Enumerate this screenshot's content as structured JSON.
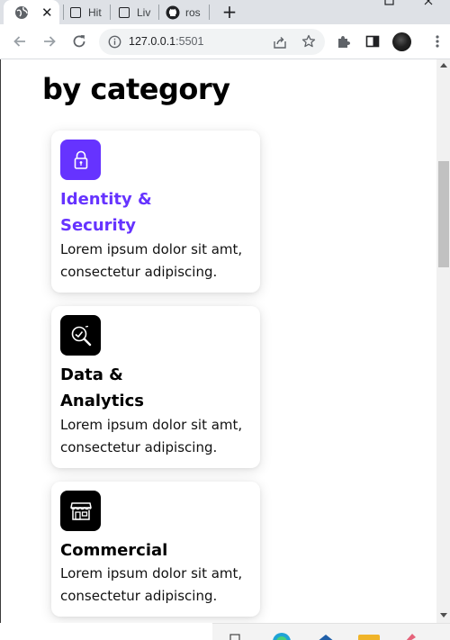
{
  "browser": {
    "tabs": [
      {
        "title": "",
        "active": true
      },
      {
        "title": "Hit",
        "active": false
      },
      {
        "title": "Liv",
        "active": false
      },
      {
        "title": "ros",
        "active": false
      }
    ],
    "url_host": "127.0.0.1",
    "url_port": ":5501"
  },
  "page": {
    "heading": "by category",
    "cards": [
      {
        "title_line1": "Identity &",
        "title_line2": "Security",
        "text_line1": "Lorem ipsum dolor sit amt,",
        "text_line2": "consectetur adipiscing.",
        "icon": "lock-icon",
        "icon_bg": "#6633ff"
      },
      {
        "title_line1": "Data &",
        "title_line2": "Analytics",
        "text_line1": "Lorem ipsum dolor sit amt,",
        "text_line2": "consectetur adipiscing.",
        "icon": "analytics-magnifier-icon",
        "icon_bg": "#000000"
      },
      {
        "title_line1": "Commercial",
        "text_line1": "Lorem ipsum dolor sit amt,",
        "text_line2": "consectetur adipiscing.",
        "icon": "storefront-icon",
        "icon_bg": "#000000"
      }
    ]
  },
  "colors": {
    "accent": "#6633ff",
    "tabstrip": "#dee1e6",
    "omnibox": "#f1f3f4"
  }
}
